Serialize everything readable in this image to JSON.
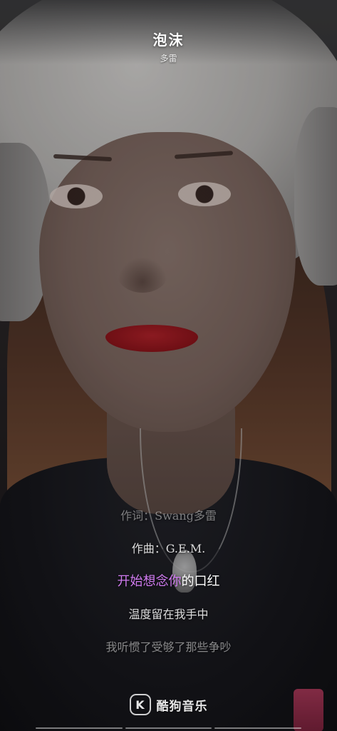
{
  "header": {
    "title": "泡沫",
    "artist": "多雷"
  },
  "lyrics": {
    "lines": [
      {
        "text": "作词：Swang多雷",
        "state": "faded-top"
      },
      {
        "text": "作曲：G.E.M.",
        "state": "dim"
      },
      {
        "sung": "开始想念你",
        "unsung": "的口红",
        "state": "active"
      },
      {
        "text": "温度留在我手中",
        "state": "next"
      },
      {
        "text": "我听惯了受够了那些争吵",
        "state": "faded-bottom"
      }
    ]
  },
  "brand": {
    "badge": "K",
    "name": "酷狗音乐"
  },
  "colors": {
    "sung_lyric": "#d07bf0",
    "lyric": "#ffffff"
  },
  "icons": {
    "brand": "kugou-logo-icon"
  }
}
